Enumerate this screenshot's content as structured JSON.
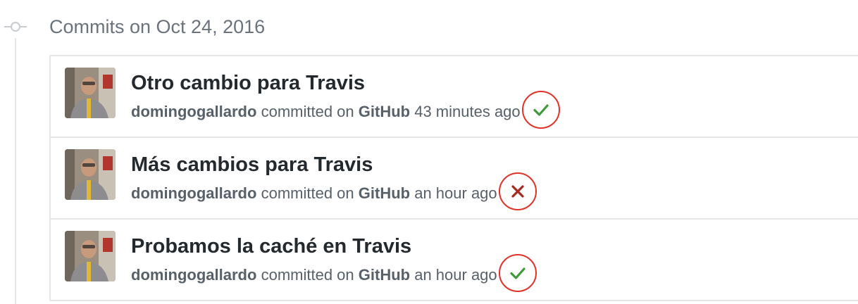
{
  "group": {
    "title": "Commits on Oct 24, 2016"
  },
  "commits": [
    {
      "title": "Otro cambio para Travis",
      "author": "domingogallardo",
      "action": "committed on",
      "platform": "GitHub",
      "time": "43 minutes ago",
      "status": "success",
      "status_icon": "check-icon"
    },
    {
      "title": "Más cambios para Travis",
      "author": "domingogallardo",
      "action": "committed on",
      "platform": "GitHub",
      "time": "an hour ago",
      "status": "failure",
      "status_icon": "x-icon"
    },
    {
      "title": "Probamos la caché en Travis",
      "author": "domingogallardo",
      "action": "committed on",
      "platform": "GitHub",
      "time": "an hour ago",
      "status": "success",
      "status_icon": "check-icon"
    }
  ],
  "colors": {
    "success": "#3e9a3a",
    "failure": "#a8281e",
    "annotation_circle": "#e03228"
  }
}
